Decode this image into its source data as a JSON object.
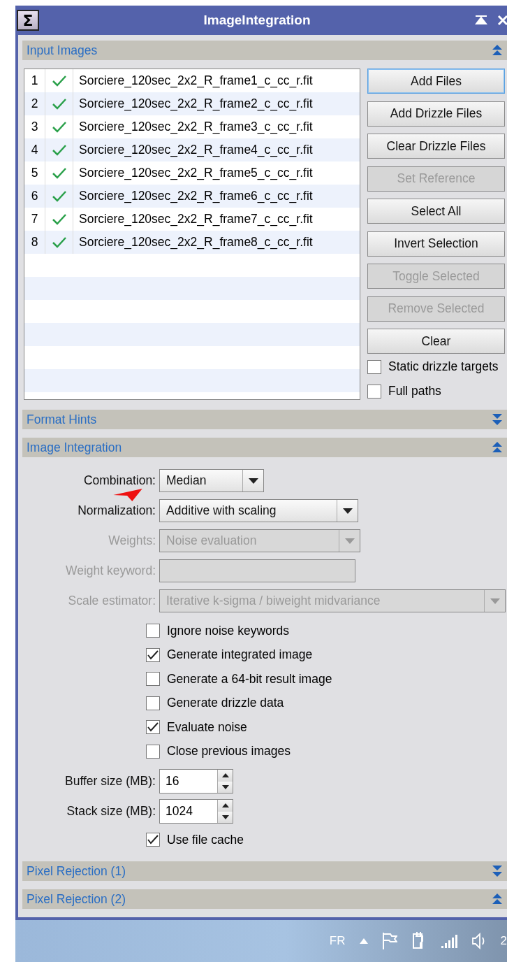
{
  "window": {
    "icon": "Σ",
    "title": "ImageIntegration"
  },
  "input_images": {
    "title": "Input Images",
    "expanded": true,
    "files": [
      {
        "index": "1",
        "enabled": true,
        "name": "Sorciere_120sec_2x2_R_frame1_c_cc_r.fit"
      },
      {
        "index": "2",
        "enabled": true,
        "name": "Sorciere_120sec_2x2_R_frame2_c_cc_r.fit"
      },
      {
        "index": "3",
        "enabled": true,
        "name": "Sorciere_120sec_2x2_R_frame3_c_cc_r.fit"
      },
      {
        "index": "4",
        "enabled": true,
        "name": "Sorciere_120sec_2x2_R_frame4_c_cc_r.fit"
      },
      {
        "index": "5",
        "enabled": true,
        "name": "Sorciere_120sec_2x2_R_frame5_c_cc_r.fit"
      },
      {
        "index": "6",
        "enabled": true,
        "name": "Sorciere_120sec_2x2_R_frame6_c_cc_r.fit"
      },
      {
        "index": "7",
        "enabled": true,
        "name": "Sorciere_120sec_2x2_R_frame7_c_cc_r.fit"
      },
      {
        "index": "8",
        "enabled": true,
        "name": "Sorciere_120sec_2x2_R_frame8_c_cc_r.fit"
      }
    ],
    "buttons": [
      {
        "label": "Add Files",
        "disabled": false,
        "focused": true
      },
      {
        "label": "Add Drizzle Files",
        "disabled": false,
        "focused": false
      },
      {
        "label": "Clear Drizzle Files",
        "disabled": false,
        "focused": false
      },
      {
        "label": "Set Reference",
        "disabled": true,
        "focused": false
      },
      {
        "label": "Select All",
        "disabled": false,
        "focused": false
      },
      {
        "label": "Invert Selection",
        "disabled": false,
        "focused": false
      },
      {
        "label": "Toggle Selected",
        "disabled": true,
        "focused": false
      },
      {
        "label": "Remove Selected",
        "disabled": true,
        "focused": false
      },
      {
        "label": "Clear",
        "disabled": false,
        "focused": false
      }
    ],
    "options": [
      {
        "label": "Static drizzle targets",
        "checked": false
      },
      {
        "label": "Full paths",
        "checked": false
      }
    ]
  },
  "format_hints": {
    "title": "Format Hints",
    "expanded": false
  },
  "image_integration": {
    "title": "Image Integration",
    "expanded": true,
    "fields": [
      {
        "kind": "combo",
        "label": "Combination:",
        "value": "Median",
        "disabled": false
      },
      {
        "kind": "combo",
        "label": "Normalization:",
        "value": "Additive with scaling",
        "disabled": false
      },
      {
        "kind": "combo",
        "label": "Weights:",
        "value": "Noise evaluation",
        "disabled": true
      },
      {
        "kind": "text",
        "label": "Weight keyword:",
        "disabled": true
      },
      {
        "kind": "combo",
        "label": "Scale estimator:",
        "value": "Iterative k-sigma / biweight midvariance",
        "disabled": true
      }
    ],
    "checkboxes": [
      {
        "label": "Ignore noise keywords",
        "checked": false
      },
      {
        "label": "Generate integrated image",
        "checked": true
      },
      {
        "label": "Generate a 64-bit result image",
        "checked": false
      },
      {
        "label": "Generate drizzle data",
        "checked": false
      },
      {
        "label": "Evaluate noise",
        "checked": true
      },
      {
        "label": "Close previous images",
        "checked": false
      }
    ],
    "spinners": [
      {
        "label": "Buffer size (MB):",
        "value": "16"
      },
      {
        "label": "Stack size (MB):",
        "value": "1024"
      }
    ],
    "cache": {
      "label": "Use file cache",
      "checked": true
    }
  },
  "pixel_rejection_1": {
    "title": "Pixel Rejection (1)",
    "expanded": false
  },
  "pixel_rejection_2": {
    "title": "Pixel Rejection (2)",
    "expanded": true
  },
  "taskbar": {
    "language": "FR",
    "clock": "2"
  }
}
